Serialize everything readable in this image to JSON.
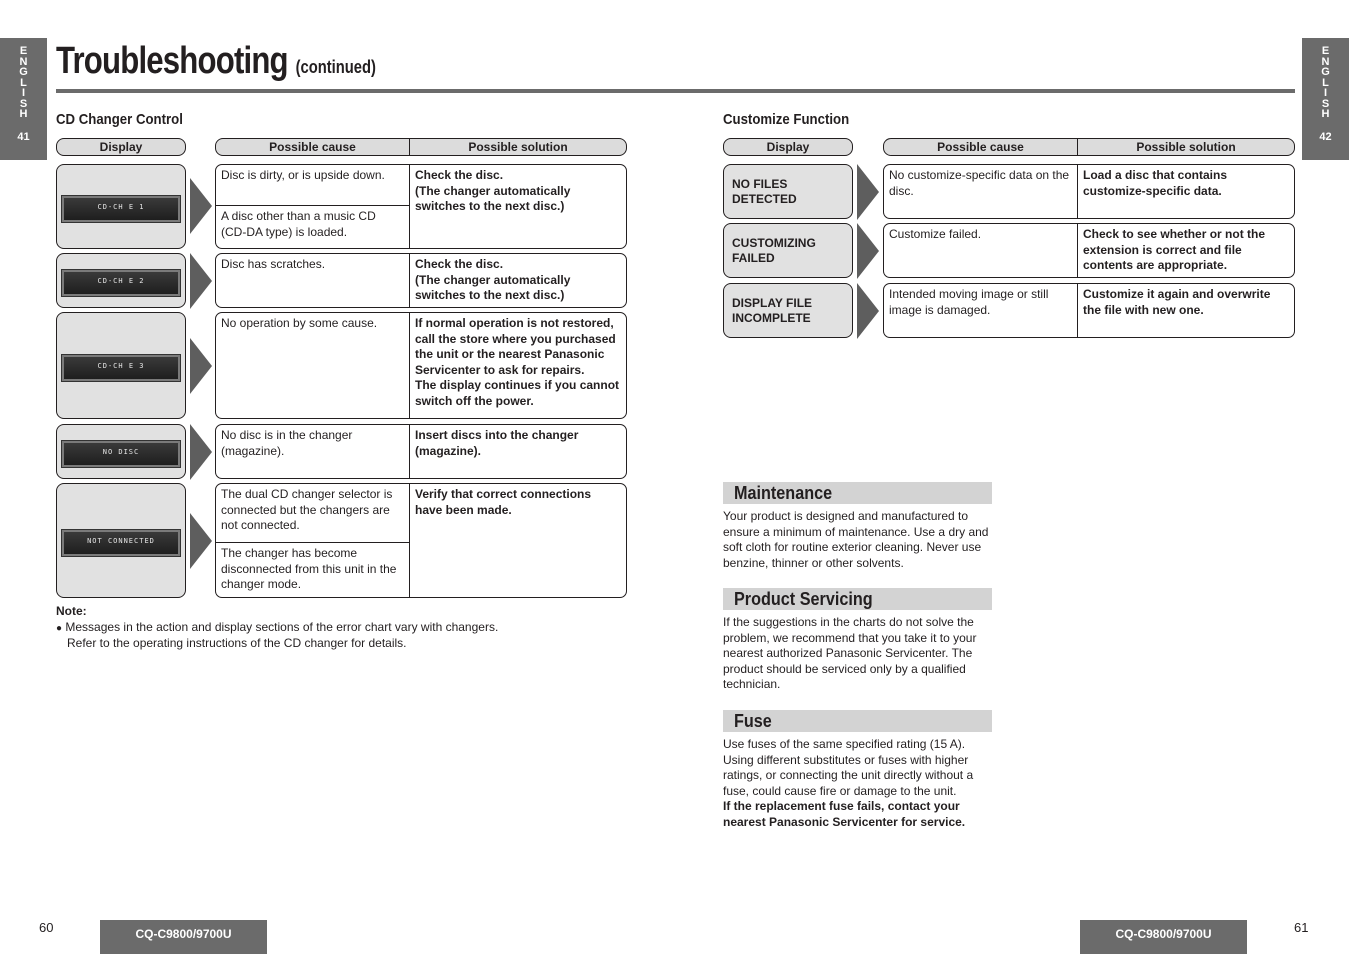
{
  "left_page": {
    "side_tab": {
      "letters": [
        "E",
        "N",
        "G",
        "L",
        "I",
        "S",
        "H"
      ],
      "page": "41"
    },
    "title": "Troubleshooting",
    "title_suffix": "(continued)",
    "section": "CD Changer Control",
    "headers": {
      "display": "Display",
      "cause": "Possible cause",
      "solution": "Possible solution"
    },
    "rows": [
      {
        "display": "CD-CH  E 1",
        "causes": [
          "Disc is dirty, or is upside down.",
          "A disc other than a music CD (CD-DA type) is loaded."
        ],
        "solution": "Check the disc.\n(The changer automatically switches to the next disc.)"
      },
      {
        "display": "CD-CH  E 2",
        "causes": [
          "Disc has scratches."
        ],
        "solution": "Check the disc.\n(The changer automatically switches to the next disc.)"
      },
      {
        "display": "CD-CH  E 3",
        "causes": [
          "No operation by some cause."
        ],
        "solution": "If normal operation is not restored, call the store where you purchased the unit or the nearest Panasonic Servicenter to ask for repairs.\nThe display continues if you cannot switch off the power."
      },
      {
        "display": "NO DISC",
        "causes": [
          "No disc is in the changer (magazine)."
        ],
        "solution": "Insert discs into the changer (magazine)."
      },
      {
        "display": "NOT CONNECTED",
        "causes": [
          "The dual CD changer selector is connected but the changers are not connected.",
          "The changer has become disconnected from this unit in the changer mode."
        ],
        "solution": "Verify that correct connections have been made."
      }
    ],
    "note_title": "Note:",
    "note_bullet": "●",
    "note_line1": "Messages in the action and display sections of the error chart vary with changers.",
    "note_line2": "Refer to the operating instructions of the CD changer for details.",
    "page_number": "60",
    "model": "CQ-C9800/9700U"
  },
  "right_page": {
    "side_tab": {
      "letters": [
        "E",
        "N",
        "G",
        "L",
        "I",
        "S",
        "H"
      ],
      "page": "42"
    },
    "section": "Customize Function",
    "headers": {
      "display": "Display",
      "cause": "Possible cause",
      "solution": "Possible solution"
    },
    "rows": [
      {
        "display": "NO FILES DETECTED",
        "causes": [
          "No customize-specific data on the disc."
        ],
        "solution": "Load a disc that contains customize-specific data."
      },
      {
        "display": "CUSTOMIZING\nFAILED",
        "causes": [
          "Customize failed."
        ],
        "solution": "Check to see whether or not the extension is correct and file contents are appropriate."
      },
      {
        "display": "DISPLAY FILE\nINCOMPLETE",
        "causes": [
          "Intended moving image or still image is damaged."
        ],
        "solution": "Customize it again and overwrite the file with new one."
      }
    ],
    "maintenance": {
      "heading": "Maintenance",
      "text": "Your product is designed and manufactured to ensure a minimum of maintenance. Use a dry and soft cloth for routine exterior cleaning. Never use benzine, thinner or other solvents."
    },
    "servicing": {
      "heading": "Product Servicing",
      "text": "If the suggestions in the charts do not solve the problem, we recommend that you take it to your nearest authorized Panasonic Servicenter. The product should be serviced only by a qualified technician."
    },
    "fuse": {
      "heading": "Fuse",
      "text": "Use fuses of the same specified rating (15 A). Using different substitutes or fuses with higher ratings, or connecting the unit directly without a fuse, could cause fire or damage to the unit.",
      "bold_text": "If the replacement fuse fails, contact your nearest Panasonic Servicenter for service."
    },
    "page_number": "61",
    "model": "CQ-C9800/9700U"
  }
}
